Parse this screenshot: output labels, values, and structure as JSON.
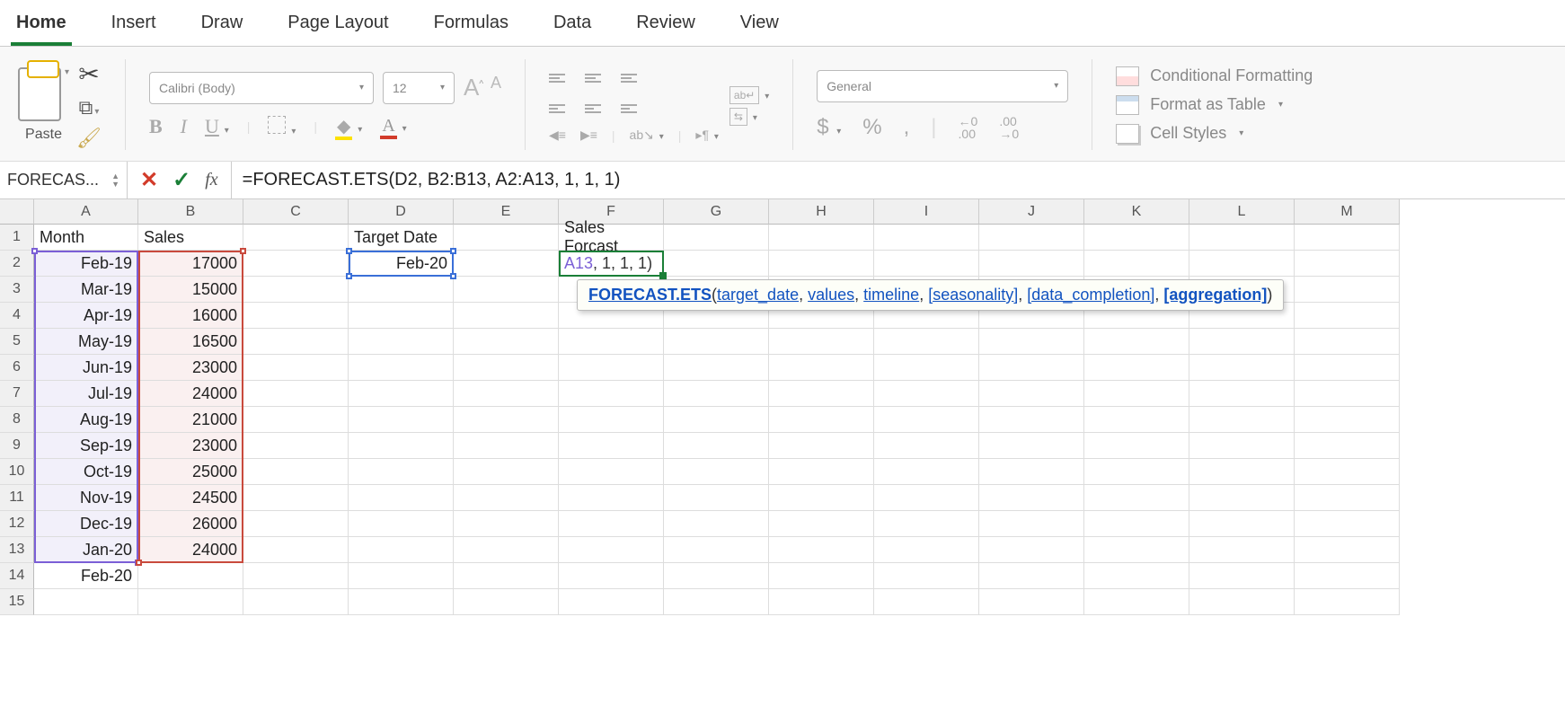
{
  "tabs": [
    "Home",
    "Insert",
    "Draw",
    "Page Layout",
    "Formulas",
    "Data",
    "Review",
    "View"
  ],
  "active_tab": "Home",
  "ribbon": {
    "paste_label": "Paste",
    "font_name": "Calibri (Body)",
    "font_size": "12",
    "number_format": "General",
    "cf": "Conditional Formatting",
    "fat": "Format as Table",
    "cs": "Cell Styles"
  },
  "name_box": "FORECAS...",
  "formula": "=FORECAST.ETS(D2, B2:B13, A2:A13, 1, 1, 1)",
  "columns": [
    "A",
    "B",
    "C",
    "D",
    "E",
    "F",
    "G",
    "H",
    "I",
    "J",
    "K",
    "L",
    "M"
  ],
  "rows_count": 15,
  "cells": {
    "A1": "Month",
    "B1": "Sales",
    "D1": "Target Date",
    "F1": "Sales Forcast",
    "A2": "Feb-19",
    "B2": "17000",
    "D2": "Feb-20",
    "A3": "Mar-19",
    "B3": "15000",
    "A4": "Apr-19",
    "B4": "16000",
    "A5": "May-19",
    "B5": "16500",
    "A6": "Jun-19",
    "B6": "23000",
    "A7": "Jul-19",
    "B7": "24000",
    "A8": "Aug-19",
    "B8": "21000",
    "A9": "Sep-19",
    "B9": "23000",
    "A10": "Oct-19",
    "B10": "25000",
    "A11": "Nov-19",
    "B11": "24500",
    "A12": "Dec-19",
    "B12": "26000",
    "A13": "Jan-20",
    "B13": "24000",
    "A14": "Feb-20"
  },
  "active_cell_frag1": "A13",
  "active_cell_frag2": ", 1, 1, 1)",
  "tooltip": {
    "fn": "FORECAST.ETS",
    "a1": "target_date",
    "a2": "values",
    "a3": "timeline",
    "a4": "[seasonality]",
    "a5": "[data_completion]",
    "a6": "[aggregation]"
  }
}
